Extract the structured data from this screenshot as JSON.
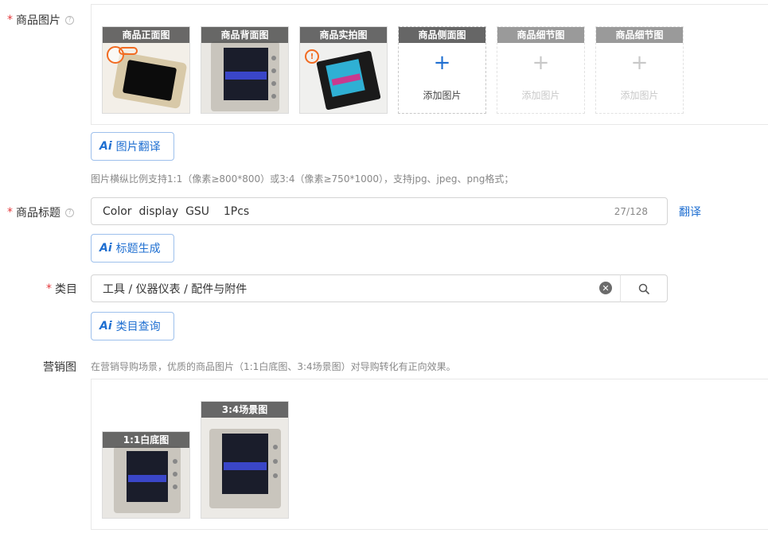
{
  "images": {
    "label": "商品图片",
    "thumbs": [
      {
        "caption": "商品正面图"
      },
      {
        "caption": "商品背面图"
      },
      {
        "caption": "商品实拍图"
      },
      {
        "caption": "商品侧面图",
        "add_text": "添加图片"
      },
      {
        "caption": "商品细节图",
        "add_text": "添加图片"
      },
      {
        "caption": "商品细节图",
        "add_text": "添加图片"
      }
    ],
    "ai_button": "图片翻译",
    "hint": "图片横纵比例支持1:1（像素≥800*800）或3:4（像素≥750*1000），支持jpg、jpeg、png格式；"
  },
  "title": {
    "label": "商品标题",
    "value": "Color  display  GSU    1Pcs",
    "counter": "27/128",
    "translate": "翻译",
    "ai_button": "标题生成"
  },
  "category": {
    "label": "类目",
    "value": "工具 / 仪器仪表 / 配件与附件",
    "ai_button": "类目查询"
  },
  "marketing": {
    "label": "营销图",
    "hint": "在营销导购场景，优质的商品图片（1:1白底图、3:4场景图）对导购转化有正向效果。",
    "thumbs": [
      {
        "caption": "1:1白底图"
      },
      {
        "caption": "3:4场景图"
      }
    ]
  },
  "colors": {
    "accent": "#1f6fd1",
    "required": "#e4393c"
  },
  "icons": [
    "help-icon",
    "plus-icon",
    "ai-icon",
    "clear-icon",
    "search-icon",
    "warning-icon"
  ]
}
